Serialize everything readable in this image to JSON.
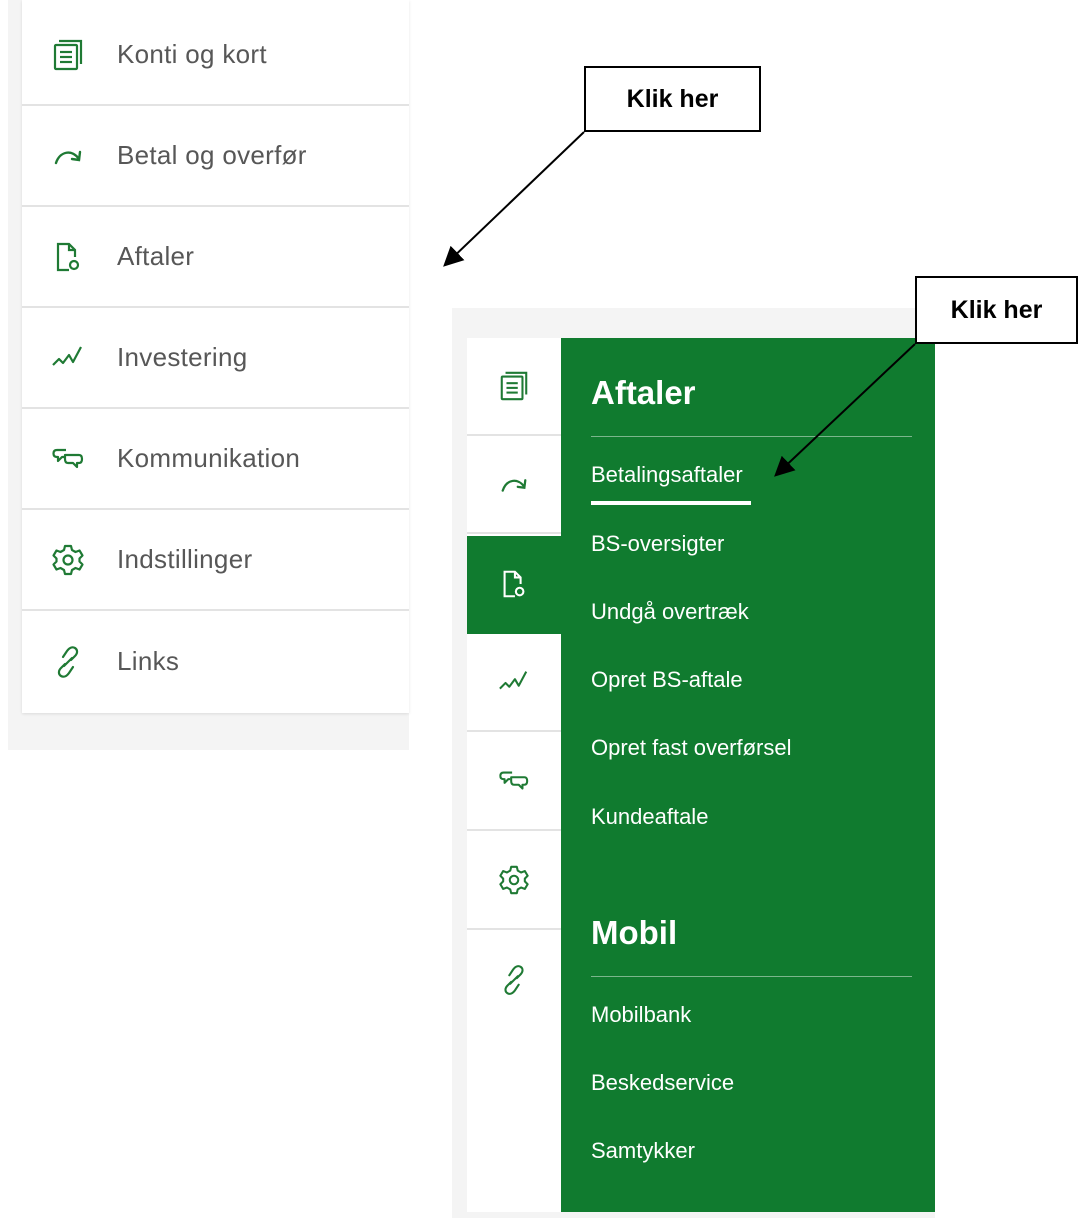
{
  "left_menu": {
    "items": [
      {
        "label": "Konti og kort",
        "icon": "accounts-list-icon"
      },
      {
        "label": "Betal og overfør",
        "icon": "curved-arrow-icon"
      },
      {
        "label": "Aftaler",
        "icon": "document-gear-icon"
      },
      {
        "label": "Investering",
        "icon": "trend-line-icon"
      },
      {
        "label": "Kommunikation",
        "icon": "chat-bubbles-icon"
      },
      {
        "label": "Indstillinger",
        "icon": "gear-icon"
      },
      {
        "label": "Links",
        "icon": "link-icon"
      }
    ]
  },
  "submenu": {
    "section1_title": "Aftaler",
    "section1_items": [
      "Betalingsaftaler",
      "BS-oversigter",
      "Undgå overtræk",
      "Opret BS-aftale",
      "Opret fast overførsel",
      "Kundeaftale"
    ],
    "section2_title": "Mobil",
    "section2_items": [
      "Mobilbank",
      "Beskedservice",
      "Samtykker"
    ]
  },
  "annotations": {
    "callout1": "Klik her",
    "callout2": "Klik her"
  },
  "colors": {
    "brand_green": "#107b2f",
    "icon_green": "#1f7a34",
    "text_gray": "#575757"
  }
}
